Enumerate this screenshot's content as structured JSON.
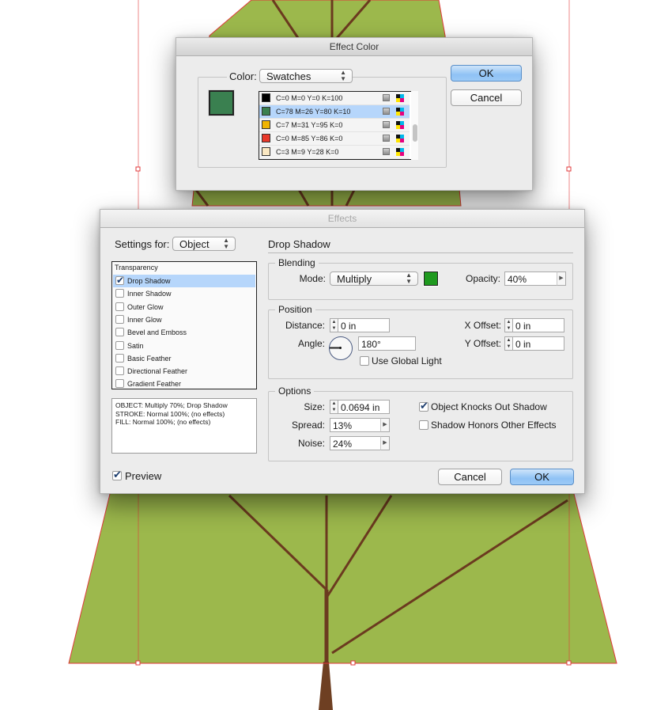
{
  "effect_color_dialog": {
    "title": "Effect Color",
    "color_label": "Color:",
    "color_source": "Swatches",
    "preview_color": "#3a8050",
    "swatches": [
      {
        "name": "C=0 M=0 Y=0 K=100",
        "color": "#000000",
        "selected": false
      },
      {
        "name": "C=78 M=26 Y=80 K=10",
        "color": "#3a8050",
        "selected": true
      },
      {
        "name": "C=7 M=31 Y=95 K=0",
        "color": "#f0b400",
        "selected": false
      },
      {
        "name": "C=0 M=85 Y=86 K=0",
        "color": "#e8382a",
        "selected": false
      },
      {
        "name": "C=3 M=9 Y=28 K=0",
        "color": "#fbe8c2",
        "selected": false
      }
    ],
    "ok_label": "OK",
    "cancel_label": "Cancel"
  },
  "effects_dialog": {
    "title": "Effects",
    "settings_for_label": "Settings for:",
    "settings_for_value": "Object",
    "effects_list_header": "Transparency",
    "effects": [
      {
        "label": "Drop Shadow",
        "checked": true,
        "selected": true
      },
      {
        "label": "Inner Shadow",
        "checked": false,
        "selected": false
      },
      {
        "label": "Outer Glow",
        "checked": false,
        "selected": false
      },
      {
        "label": "Inner Glow",
        "checked": false,
        "selected": false
      },
      {
        "label": "Bevel and Emboss",
        "checked": false,
        "selected": false
      },
      {
        "label": "Satin",
        "checked": false,
        "selected": false
      },
      {
        "label": "Basic Feather",
        "checked": false,
        "selected": false
      },
      {
        "label": "Directional Feather",
        "checked": false,
        "selected": false
      },
      {
        "label": "Gradient Feather",
        "checked": false,
        "selected": false
      }
    ],
    "summary_lines": [
      "OBJECT: Multiply 70%; Drop Shadow",
      "STROKE: Normal 100%; (no effects)",
      "FILL: Normal 100%; (no effects)"
    ],
    "preview_label": "Preview",
    "preview_checked": true,
    "panel_title": "Drop Shadow",
    "blending": {
      "group_label": "Blending",
      "mode_label": "Mode:",
      "mode_value": "Multiply",
      "shadow_color": "#1f9a1f",
      "opacity_label": "Opacity:",
      "opacity_value": "40%"
    },
    "position": {
      "group_label": "Position",
      "distance_label": "Distance:",
      "distance_value": "0 in",
      "angle_label": "Angle:",
      "angle_value": "180°",
      "angle_degrees": 180,
      "use_global_light_label": "Use Global Light",
      "use_global_light_checked": false,
      "x_offset_label": "X Offset:",
      "x_offset_value": "0 in",
      "y_offset_label": "Y Offset:",
      "y_offset_value": "0 in"
    },
    "options": {
      "group_label": "Options",
      "size_label": "Size:",
      "size_value": "0.0694 in",
      "spread_label": "Spread:",
      "spread_value": "13%",
      "noise_label": "Noise:",
      "noise_value": "24%",
      "knocks_out_label": "Object Knocks Out Shadow",
      "knocks_out_checked": true,
      "honors_label": "Shadow Honors Other Effects",
      "honors_checked": false
    },
    "cancel_label": "Cancel",
    "ok_label": "OK"
  },
  "artwork": {
    "foliage_color": "#9cb84c",
    "branch_color": "#6b3a1f",
    "trunk_color": "#6e3f22",
    "selection_color": "#e0393b"
  }
}
